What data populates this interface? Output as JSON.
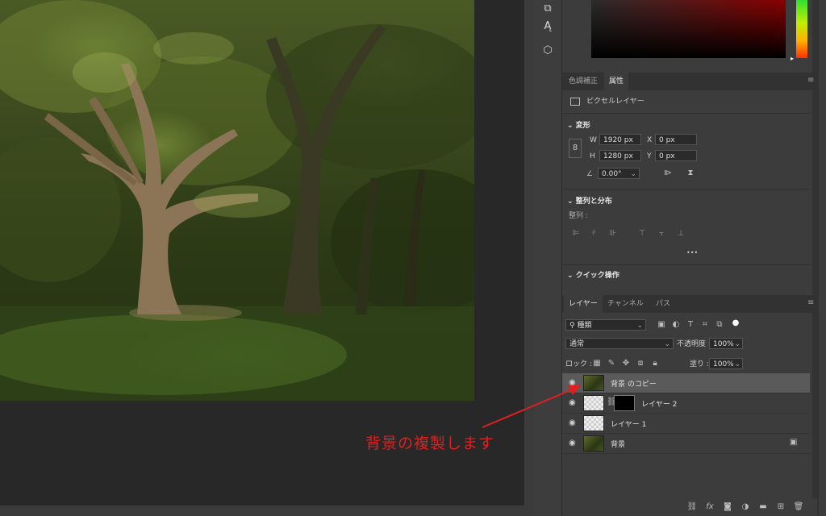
{
  "properties_panel": {
    "tabs": [
      "色調補正",
      "属性"
    ],
    "layer_type": "ピクセルレイヤー",
    "transform": {
      "section_label": "変形",
      "w_label": "W",
      "w_value": "1920 px",
      "h_label": "H",
      "h_value": "1280 px",
      "x_label": "X",
      "x_value": "0 px",
      "y_label": "Y",
      "y_value": "0 px",
      "angle_value": "0.00°"
    },
    "align": {
      "section_label": "整列と分布",
      "sub_label": "整列 :",
      "more": "•••"
    },
    "quick_actions_label": "クイック操作"
  },
  "layers_panel": {
    "tabs": [
      "レイヤー",
      "チャンネル",
      "パス"
    ],
    "filter_kind": "種類",
    "blend_mode": "通常",
    "opacity_label": "不透明度 :",
    "opacity_value": "100%",
    "lock_label": "ロック :",
    "fill_label": "塗り :",
    "fill_value": "100%",
    "layers": [
      {
        "name": "背景 のコピー",
        "selected": true
      },
      {
        "name": "レイヤー 2",
        "selected": false
      },
      {
        "name": "レイヤー 1",
        "selected": false
      },
      {
        "name": "背景",
        "selected": false,
        "locked": true
      }
    ],
    "footer_icons": [
      "link-icon",
      "fx-icon",
      "mask-icon",
      "adjustment-icon",
      "folder-icon",
      "new-layer-icon",
      "trash-icon"
    ]
  },
  "annotation": {
    "text": "背景の複製します",
    "color": "#e02020"
  },
  "colors": {
    "panel_bg": "#3c3c3c",
    "canvas_bg": "#282828",
    "selected_row": "#5a5a5a"
  }
}
